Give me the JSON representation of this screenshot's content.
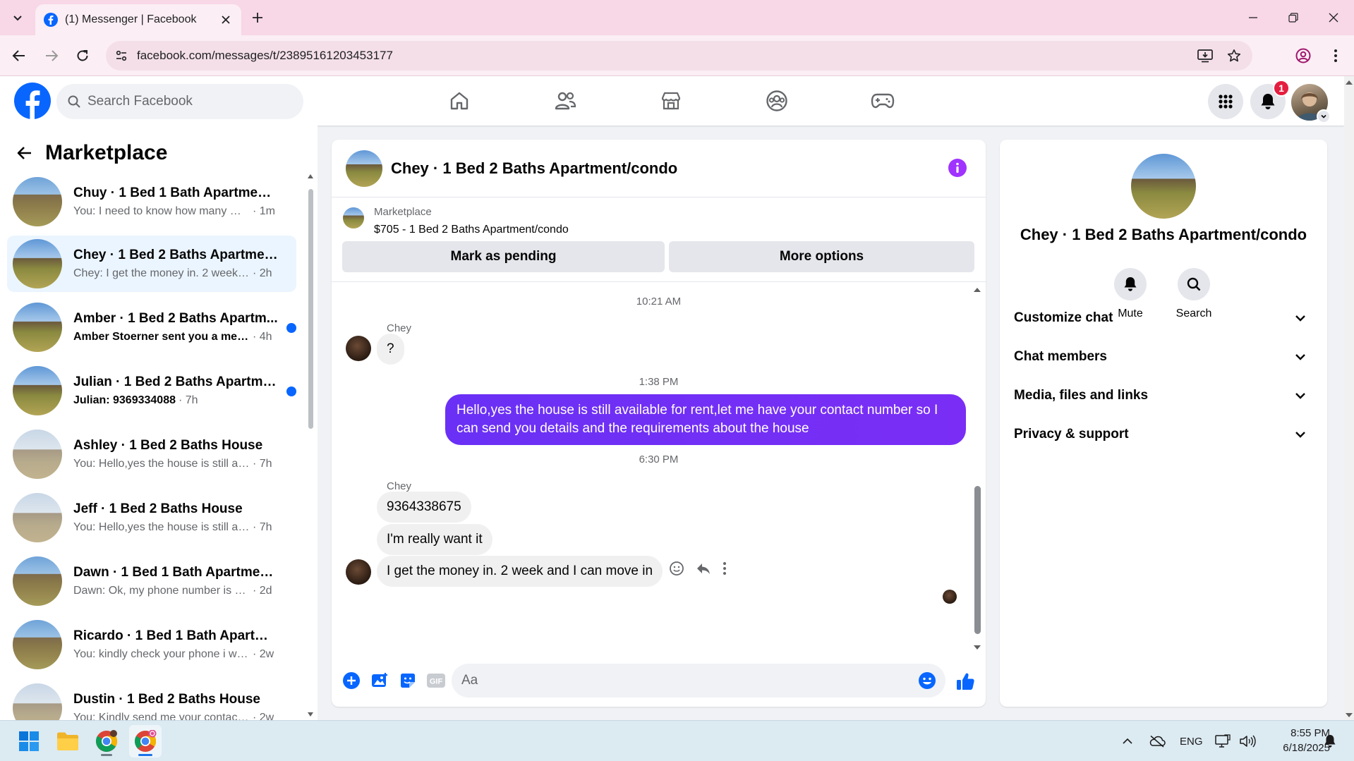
{
  "browser": {
    "tab_title": "(1) Messenger | Facebook",
    "url": "facebook.com/messages/t/23895161203453177"
  },
  "header": {
    "search_placeholder": "Search Facebook",
    "notification_count": "1"
  },
  "left_panel": {
    "title": "Marketplace",
    "chats": [
      {
        "name": "Chuy · 1 Bed 1 Bath Apartment/c...",
        "preview": "You: I need to know how many me...",
        "time": "· 1m",
        "unread": false,
        "active": false
      },
      {
        "name": "Chey · 1 Bed 2 Baths Apartment/...",
        "preview": "Chey: I get the money in. 2 week a...",
        "time": "· 2h",
        "unread": false,
        "active": true
      },
      {
        "name": "Amber · 1 Bed 2 Baths Apartm...",
        "preview": "Amber Stoerner sent you a mes...",
        "time": "· 4h",
        "unread": true,
        "active": false
      },
      {
        "name": "Julian · 1 Bed 2 Baths Apartme...",
        "preview": "Julian: 9369334088",
        "time": "· 7h",
        "unread": true,
        "active": false
      },
      {
        "name": "Ashley · 1 Bed 2 Baths House",
        "preview": "You: Hello,yes the house is still avail...",
        "time": "· 7h",
        "unread": false,
        "active": false
      },
      {
        "name": "Jeff · 1 Bed 2 Baths House",
        "preview": "You: Hello,yes the house is still avail...",
        "time": "· 7h",
        "unread": false,
        "active": false
      },
      {
        "name": "Dawn · 1 Bed 1 Bath Apartment/...",
        "preview": "Dawn: Ok, my phone number is 93...",
        "time": "· 2d",
        "unread": false,
        "active": false
      },
      {
        "name": "Ricardo · 1 Bed 1 Bath Apartmen...",
        "preview": "You: kindly check your phone i will ...",
        "time": "· 2w",
        "unread": false,
        "active": false
      },
      {
        "name": "Dustin · 1 Bed 2 Baths House",
        "preview": "You: Kindly send me your contact ...",
        "time": "· 2w",
        "unread": false,
        "active": false
      }
    ]
  },
  "conversation": {
    "title": "Chey · 1 Bed 2 Baths Apartment/condo",
    "marketplace_label": "Marketplace",
    "listing": "$705 - 1 Bed 2 Baths Apartment/condo",
    "mark_pending_label": "Mark as pending",
    "more_options_label": "More options",
    "messages": {
      "ts1": "10:21 AM",
      "sender1": "Chey",
      "m1": "?",
      "ts2": "1:38 PM",
      "out1": "Hello,yes the house is still available for rent,let me have your contact number   so I can send you details and the requirements about the house",
      "ts3": "6:30 PM",
      "sender2": "Chey",
      "m2": "9364338675",
      "m3": "I'm really want it",
      "m4": "I get the money in. 2 week and I can move in"
    },
    "composer_placeholder": "Aa"
  },
  "info_panel": {
    "name": "Chey · 1 Bed 2 Baths Apartment/condo",
    "mute_label": "Mute",
    "search_label": "Search",
    "rows": [
      "Customize chat",
      "Chat members",
      "Media, files and links",
      "Privacy & support"
    ]
  },
  "taskbar": {
    "language": "ENG",
    "time": "8:55 PM",
    "date": "6/18/2025"
  },
  "colors": {
    "fb_blue": "#0866ff",
    "accent_purple": "#7a2ef5",
    "info_purple": "#a033ff",
    "tab_strip": "#f8d7e6"
  }
}
